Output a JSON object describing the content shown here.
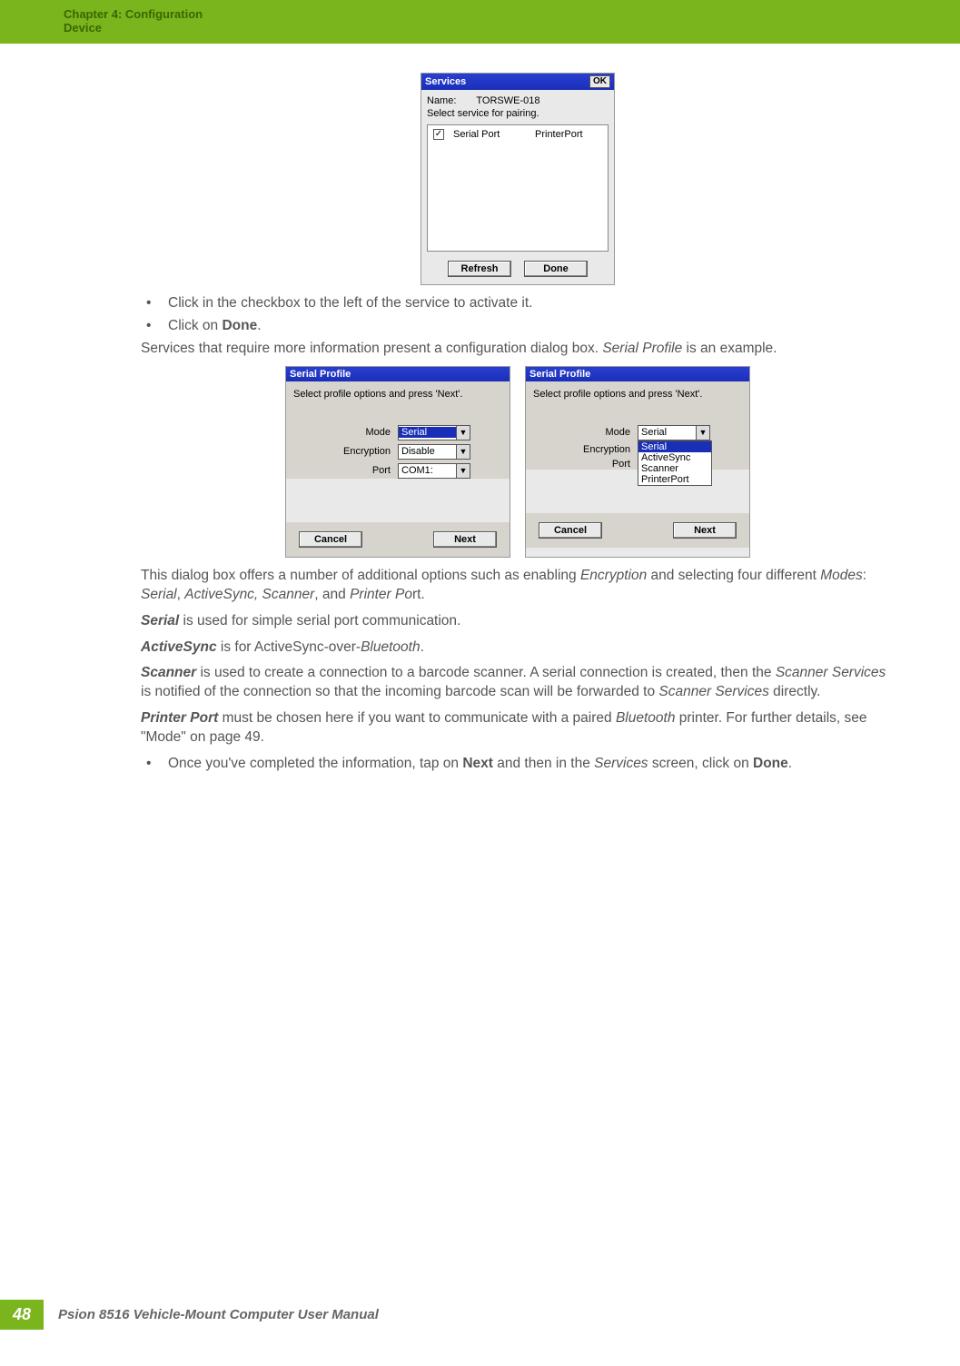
{
  "header": {
    "chapter": "Chapter 4:  Configuration",
    "section": "Device"
  },
  "services_dialog": {
    "title": "Services",
    "ok": "OK",
    "name_label": "Name:",
    "name_value": "TORSWE-018",
    "select_text": "Select service for pairing.",
    "item1": "Serial Port",
    "item2": "PrinterPort",
    "refresh": "Refresh",
    "done": "Done"
  },
  "bullets1": {
    "b1a": "Click in the checkbox to the left of the service to activate it.",
    "b2a": "Click on ",
    "b2b": "Done",
    "b2c": "."
  },
  "para1": {
    "t1": "Services that require more information present a configuration dialog box. ",
    "t2": "Serial Profile",
    "t3": " is an example."
  },
  "sp_left": {
    "title": "Serial Profile",
    "hint": "Select profile options and press 'Next'.",
    "mode_label": "Mode",
    "mode_val": "Serial",
    "enc_label": "Encryption",
    "enc_val": "Disable",
    "port_label": "Port",
    "port_val": "COM1:",
    "cancel": "Cancel",
    "next": "Next"
  },
  "sp_right": {
    "title": "Serial Profile",
    "hint": "Select profile options and press 'Next'.",
    "mode_label": "Mode",
    "mode_val": "Serial",
    "enc_label": "Encryption",
    "port_label": "Port",
    "opt1": "Serial",
    "opt2": "ActiveSync",
    "opt3": "Scanner",
    "opt4": "PrinterPort",
    "cancel": "Cancel",
    "next": "Next"
  },
  "para2": {
    "t1": "This dialog box offers a number of additional options such as enabling ",
    "t2": "Encryption",
    "t3": " and selecting four different ",
    "t4": "Modes",
    "t5": ": ",
    "t6": "Serial",
    "t7": ", ",
    "t8": "ActiveSync, Scanner",
    "t9": ", and ",
    "t10": "Printer Po",
    "t11": "rt."
  },
  "para3": {
    "t1": "Serial",
    "t2": " is used for simple serial port communication."
  },
  "para4": {
    "t1": "ActiveSync",
    "t2": " is for ActiveSync-over-",
    "t3": "Bluetooth",
    "t4": "."
  },
  "para5": {
    "t1": "Scanner",
    "t2": " is used to create a connection to a barcode scanner. A serial connection is created, then the ",
    "t3": "Scanner Services",
    "t4": " is notified of the connection so that the incoming barcode scan will be forwarded to ",
    "t5": "Scanner Services",
    "t6": " directly."
  },
  "para6": {
    "t1": "Printer Port",
    "t2": " must be chosen here if you want to communicate with a paired ",
    "t3": "Bluetooth",
    "t4": " printer. For further details, see \"Mode\" on page 49."
  },
  "bullets2": {
    "b1a": "Once you've completed the information, tap on ",
    "b1b": "Next",
    "b1c": " and then in the ",
    "b1d": "Services",
    "b1e": " screen, click on ",
    "b1f": "Done",
    "b1g": "."
  },
  "footer": {
    "page": "48",
    "title": "Psion 8516 Vehicle-Mount Computer User Manual"
  }
}
